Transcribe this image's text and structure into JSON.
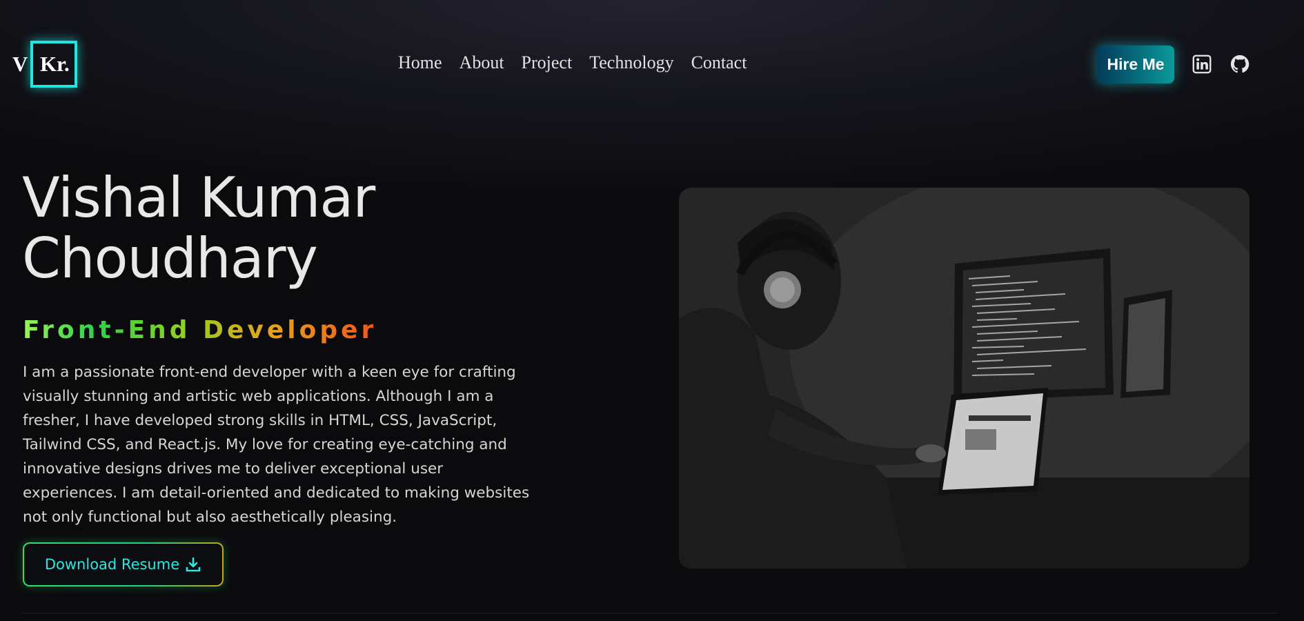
{
  "header": {
    "logo_v": "V",
    "logo_kr": "Kr.",
    "nav": [
      "Home",
      "About",
      "Project",
      "Technology",
      "Contact"
    ],
    "hire_label": "Hire Me",
    "social": [
      "linkedin-icon",
      "github-icon"
    ]
  },
  "hero": {
    "name_line1": "Vishal Kumar",
    "name_line2": "Choudhary",
    "role": "Front-End Developer",
    "bio": "I am a passionate front-end developer with a keen eye for crafting visually stunning and artistic web applications. Although I am a fresher, I have developed strong skills in HTML, CSS, JavaScript, Tailwind CSS, and React.js. My love for creating eye-catching and innovative designs drives me to deliver exceptional user experiences. I am detail-oriented and dedicated to making websites not only functional but also aesthetically pleasing.",
    "resume_label": "Download Resume",
    "resume_icon": "download-icon"
  },
  "colors": {
    "accent_cyan": "#1ee6e0",
    "hire_gradient_start": "#033a5a",
    "hire_gradient_end": "#0a9a9a",
    "role_gradient": [
      "#9cf25a",
      "#2ed14a",
      "#8fd11e",
      "#e9a21a",
      "#f0551e"
    ],
    "background": "#0b0b0e"
  }
}
